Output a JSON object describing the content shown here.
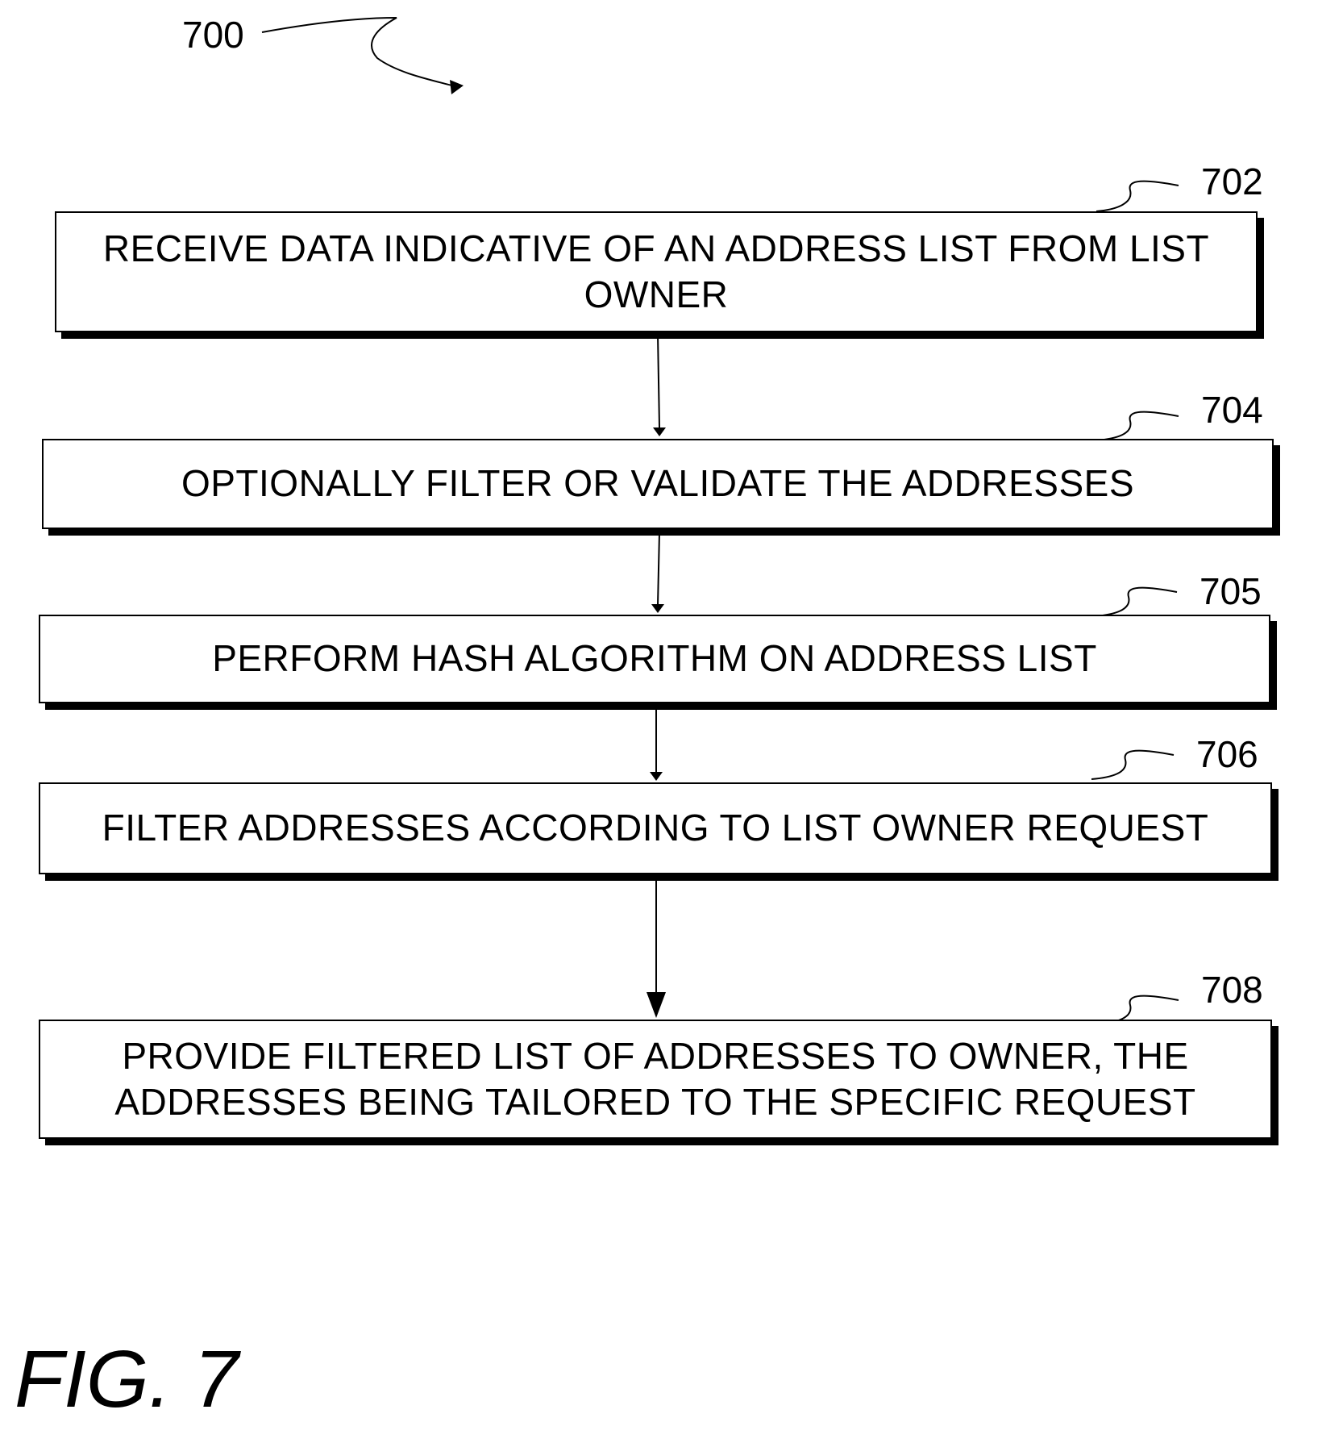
{
  "figure": {
    "ref": "700",
    "label": "FIG. 7"
  },
  "steps": [
    {
      "ref": "702",
      "text": "RECEIVE DATA INDICATIVE OF AN ADDRESS LIST FROM LIST\nOWNER"
    },
    {
      "ref": "704",
      "text": "OPTIONALLY FILTER OR VALIDATE THE ADDRESSES"
    },
    {
      "ref": "705",
      "text": "PERFORM HASH ALGORITHM ON ADDRESS LIST"
    },
    {
      "ref": "706",
      "text": "FILTER ADDRESSES ACCORDING TO LIST OWNER REQUEST"
    },
    {
      "ref": "708",
      "text": "PROVIDE FILTERED LIST OF ADDRESSES TO OWNER, THE\nADDRESSES BEING TAILORED TO THE SPECIFIC REQUEST"
    }
  ],
  "colors": {
    "line": "#000000",
    "background": "#ffffff"
  }
}
